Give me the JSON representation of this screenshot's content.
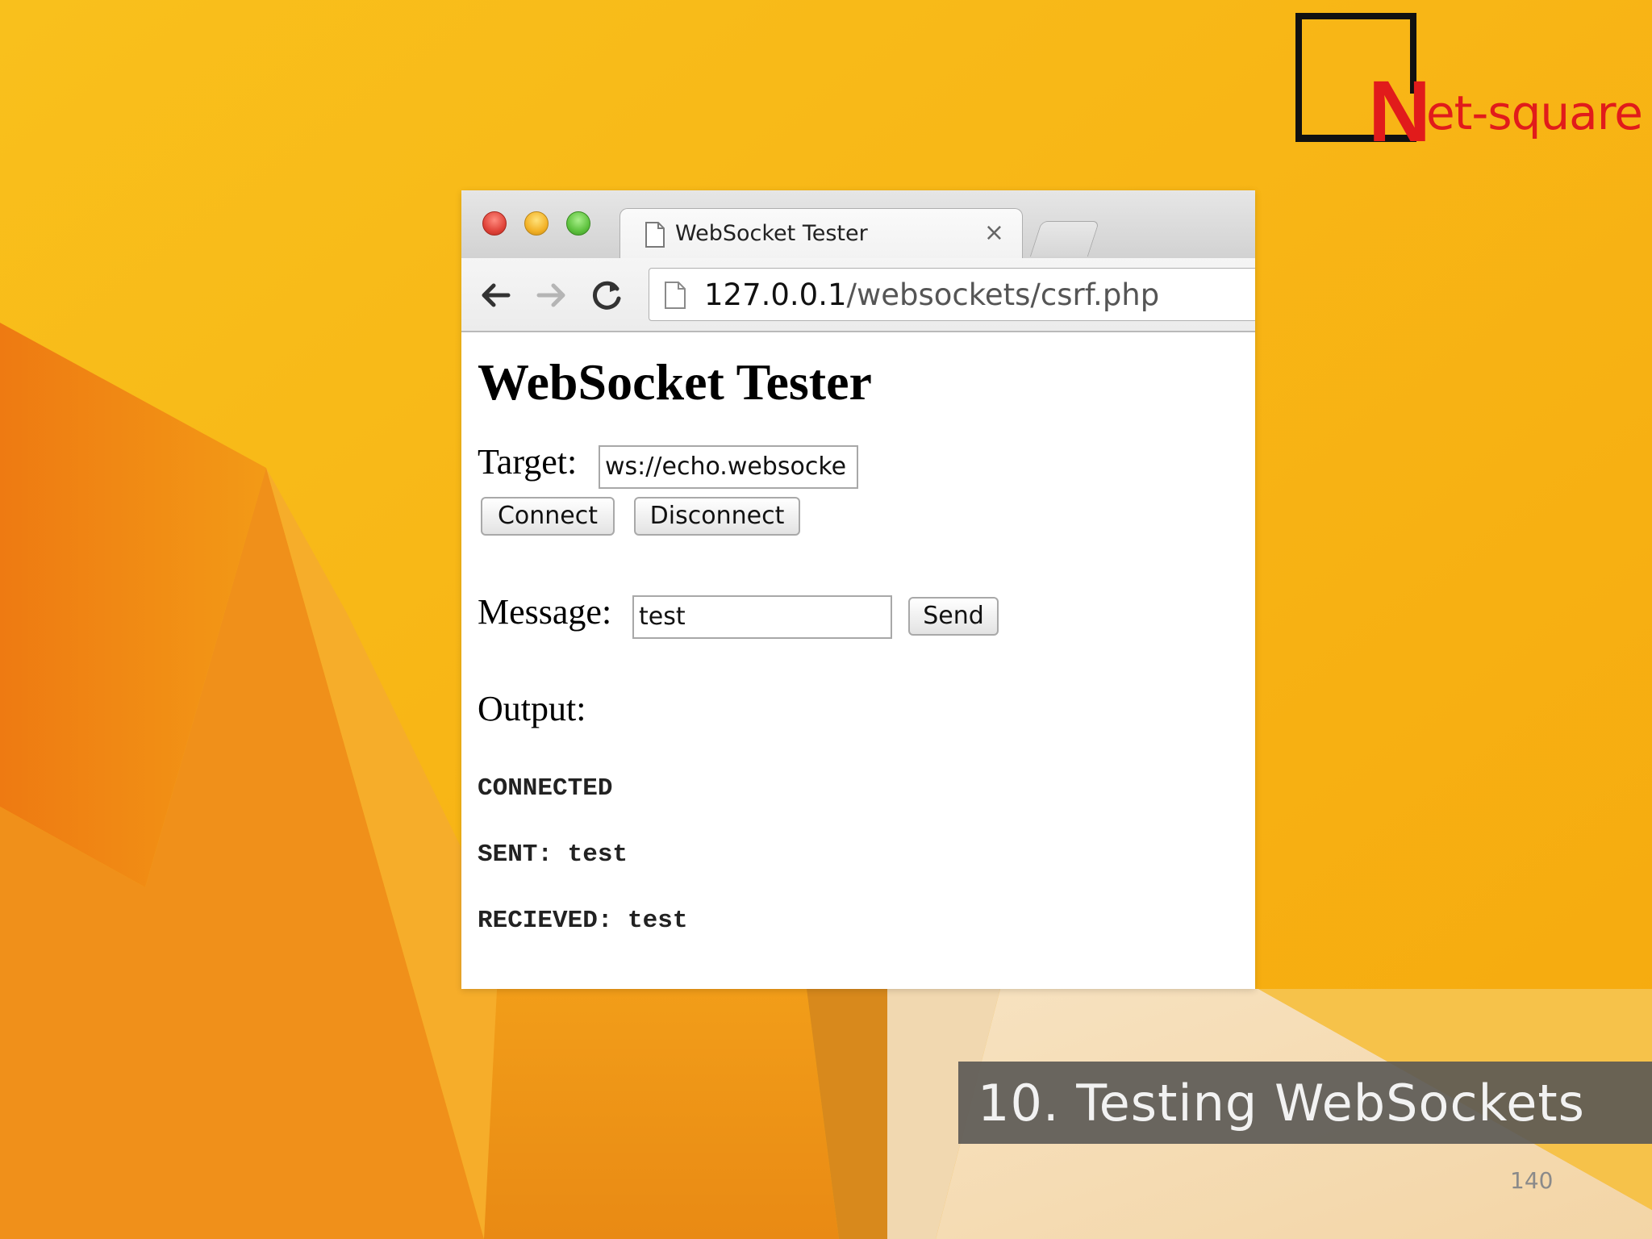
{
  "slide": {
    "logo_mark": "N",
    "logo_rest": "et-square",
    "caption": "10. Testing WebSockets",
    "page_number": "140"
  },
  "browser": {
    "tab_title": "WebSocket Tester",
    "tab_close": "×",
    "url_host": "127.0.0.1",
    "url_path": "/websockets/csrf.php"
  },
  "page": {
    "title": "WebSocket Tester",
    "target_label": "Target:",
    "target_value": "ws://echo.websocke",
    "connect_label": "Connect",
    "disconnect_label": "Disconnect",
    "message_label": "Message:",
    "message_value": "test",
    "send_label": "Send",
    "output_label": "Output:",
    "output_lines": [
      "CONNECTED",
      "SENT: test",
      "RECIEVED: test"
    ]
  },
  "colors": {
    "background": "#F8B612",
    "logo_red": "#E11B1B",
    "caption_bg": "#5A5854"
  }
}
